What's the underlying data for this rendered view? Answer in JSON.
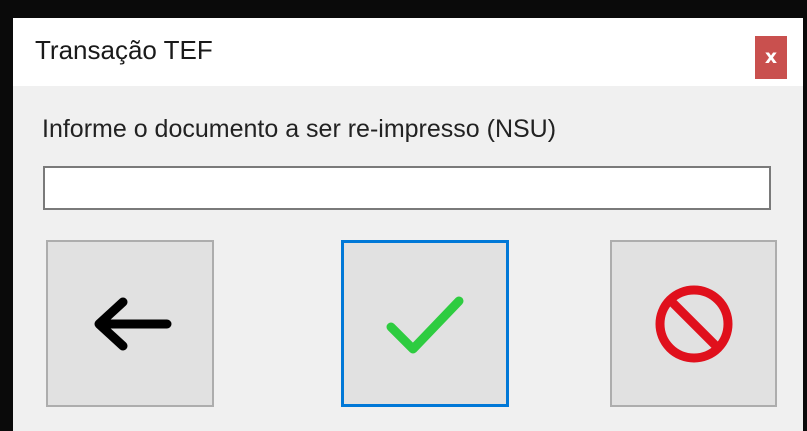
{
  "window": {
    "title": "Transação TEF",
    "close_label": "x"
  },
  "form": {
    "prompt": "Informe o documento a ser re-impresso (NSU)",
    "nsu_value": ""
  },
  "buttons": [
    {
      "name": "back",
      "icon": "arrow-left-icon",
      "color": "#000000"
    },
    {
      "name": "confirm",
      "icon": "checkmark-icon",
      "color": "#2ecc40",
      "focused": true
    },
    {
      "name": "cancel",
      "icon": "prohibited-icon",
      "color": "#e0101c"
    }
  ],
  "colors": {
    "accent_focus": "#0078d7",
    "close_button": "#c9504e"
  }
}
